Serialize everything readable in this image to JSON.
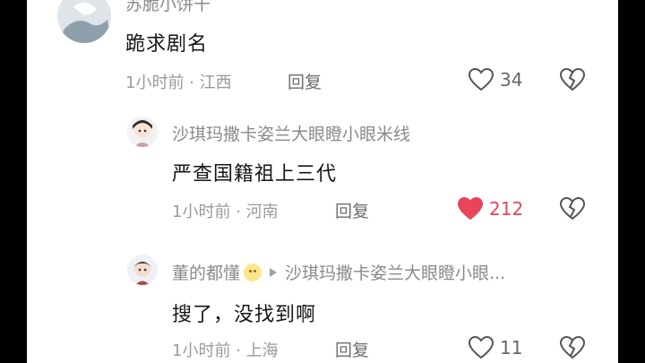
{
  "comments": [
    {
      "username": "苏脆小饼干",
      "content": "跪求剧名",
      "time": "1小时前",
      "location": "江西",
      "reply_label": "回复",
      "likes": "34",
      "liked": false
    },
    {
      "username": "沙琪玛撒卡姿兰大眼瞪小眼米线",
      "content": "严查国籍祖上三代",
      "time": "1小时前",
      "location": "河南",
      "reply_label": "回复",
      "likes": "212",
      "liked": true
    },
    {
      "username": "董的都懂",
      "reply_to": "沙琪玛撒卡姿兰大眼瞪小眼...",
      "content": "搜了，没找到啊",
      "time": "1小时前",
      "location": "上海",
      "reply_label": "回复",
      "likes": "11",
      "liked": false
    }
  ],
  "colors": {
    "like_active": "#e8445a",
    "text_primary": "#161616",
    "text_secondary": "#9a9a9a"
  },
  "icons": {
    "like": "heart-outline-icon",
    "liked": "heart-filled-icon",
    "dislike": "broken-heart-icon"
  }
}
